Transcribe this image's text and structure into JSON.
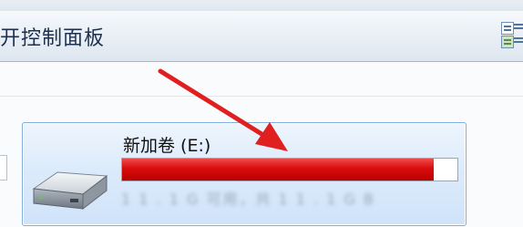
{
  "toolbar": {
    "label": "开控制面板"
  },
  "drive": {
    "name": "新加卷 (E:)",
    "used_fraction": 0.93,
    "free_text": "1 1 . 1 G 可用，共 1 1 . 1 G B"
  },
  "colors": {
    "bar_fill": "#d80c0c",
    "tile_border": "#84acdd",
    "arrow": "#e02020"
  },
  "icons": {
    "drive": "hard-drive-icon",
    "view_large": "view-details-icon",
    "view_small": "view-tiles-icon",
    "annotation": "red-arrow"
  }
}
